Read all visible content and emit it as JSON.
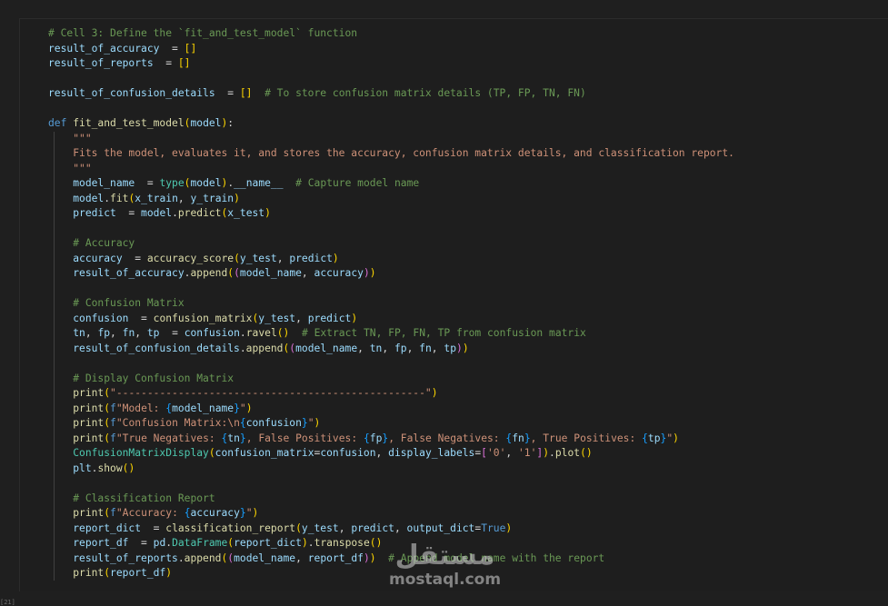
{
  "code_lines": [
    [
      [
        "cm",
        "# Cell 3: Define the `fit_and_test_model` function"
      ]
    ],
    [
      [
        "var",
        "result_of_accuracy"
      ],
      [
        "",
        "  = "
      ],
      [
        "brk",
        "[]"
      ]
    ],
    [
      [
        "var",
        "result_of_reports"
      ],
      [
        "",
        "  = "
      ],
      [
        "brk",
        "[]"
      ]
    ],
    [],
    [
      [
        "var",
        "result_of_confusion_details"
      ],
      [
        "",
        "  = "
      ],
      [
        "brk",
        "[]"
      ],
      [
        "",
        "  "
      ],
      [
        "cm",
        "# To store confusion matrix details (TP, FP, TN, FN)"
      ]
    ],
    [],
    [
      [
        "kw",
        "def"
      ],
      [
        "",
        " "
      ],
      [
        "fn",
        "fit_and_test_model"
      ],
      [
        "brk",
        "("
      ],
      [
        "var",
        "model"
      ],
      [
        "brk",
        ")"
      ],
      [
        "",
        ":"
      ]
    ],
    [
      [
        "",
        "    "
      ],
      [
        "str",
        "\"\"\""
      ]
    ],
    [
      [
        "",
        "    "
      ],
      [
        "str",
        "Fits the model, evaluates it, and stores the accuracy, confusion matrix details, and classification report."
      ]
    ],
    [
      [
        "",
        "    "
      ],
      [
        "str",
        "\"\"\""
      ]
    ],
    [
      [
        "",
        "    "
      ],
      [
        "var",
        "model_name"
      ],
      [
        "",
        "  = "
      ],
      [
        "cls",
        "type"
      ],
      [
        "brk",
        "("
      ],
      [
        "var",
        "model"
      ],
      [
        "brk",
        ")"
      ],
      [
        "",
        "."
      ],
      [
        "var",
        "__name__"
      ],
      [
        "",
        "  "
      ],
      [
        "cm",
        "# Capture model name"
      ]
    ],
    [
      [
        "",
        "    "
      ],
      [
        "var",
        "model"
      ],
      [
        "",
        "."
      ],
      [
        "fn",
        "fit"
      ],
      [
        "brk",
        "("
      ],
      [
        "var",
        "x_train"
      ],
      [
        "",
        ", "
      ],
      [
        "var",
        "y_train"
      ],
      [
        "brk",
        ")"
      ]
    ],
    [
      [
        "",
        "    "
      ],
      [
        "var",
        "predict"
      ],
      [
        "",
        "  = "
      ],
      [
        "var",
        "model"
      ],
      [
        "",
        "."
      ],
      [
        "fn",
        "predict"
      ],
      [
        "brk",
        "("
      ],
      [
        "var",
        "x_test"
      ],
      [
        "brk",
        ")"
      ]
    ],
    [],
    [
      [
        "",
        "    "
      ],
      [
        "cm",
        "# Accuracy"
      ]
    ],
    [
      [
        "",
        "    "
      ],
      [
        "var",
        "accuracy"
      ],
      [
        "",
        "  = "
      ],
      [
        "fn",
        "accuracy_score"
      ],
      [
        "brk",
        "("
      ],
      [
        "var",
        "y_test"
      ],
      [
        "",
        ", "
      ],
      [
        "var",
        "predict"
      ],
      [
        "brk",
        ")"
      ]
    ],
    [
      [
        "",
        "    "
      ],
      [
        "var",
        "result_of_accuracy"
      ],
      [
        "",
        "."
      ],
      [
        "fn",
        "append"
      ],
      [
        "brk",
        "("
      ],
      [
        "brk2",
        "("
      ],
      [
        "var",
        "model_name"
      ],
      [
        "",
        ", "
      ],
      [
        "var",
        "accuracy"
      ],
      [
        "brk2",
        ")"
      ],
      [
        "brk",
        ")"
      ]
    ],
    [],
    [
      [
        "",
        "    "
      ],
      [
        "cm",
        "# Confusion Matrix"
      ]
    ],
    [
      [
        "",
        "    "
      ],
      [
        "var",
        "confusion"
      ],
      [
        "",
        "  = "
      ],
      [
        "fn",
        "confusion_matrix"
      ],
      [
        "brk",
        "("
      ],
      [
        "var",
        "y_test"
      ],
      [
        "",
        ", "
      ],
      [
        "var",
        "predict"
      ],
      [
        "brk",
        ")"
      ]
    ],
    [
      [
        "",
        "    "
      ],
      [
        "var",
        "tn"
      ],
      [
        "",
        ", "
      ],
      [
        "var",
        "fp"
      ],
      [
        "",
        ", "
      ],
      [
        "var",
        "fn"
      ],
      [
        "",
        ", "
      ],
      [
        "var",
        "tp"
      ],
      [
        "",
        "  = "
      ],
      [
        "var",
        "confusion"
      ],
      [
        "",
        "."
      ],
      [
        "fn",
        "ravel"
      ],
      [
        "brk",
        "()"
      ],
      [
        "",
        "  "
      ],
      [
        "cm",
        "# Extract TN, FP, FN, TP from confusion matrix"
      ]
    ],
    [
      [
        "",
        "    "
      ],
      [
        "var",
        "result_of_confusion_details"
      ],
      [
        "",
        "."
      ],
      [
        "fn",
        "append"
      ],
      [
        "brk",
        "("
      ],
      [
        "brk2",
        "("
      ],
      [
        "var",
        "model_name"
      ],
      [
        "",
        ", "
      ],
      [
        "var",
        "tn"
      ],
      [
        "",
        ", "
      ],
      [
        "var",
        "fp"
      ],
      [
        "",
        ", "
      ],
      [
        "var",
        "fn"
      ],
      [
        "",
        ", "
      ],
      [
        "var",
        "tp"
      ],
      [
        "brk2",
        ")"
      ],
      [
        "brk",
        ")"
      ]
    ],
    [],
    [
      [
        "",
        "    "
      ],
      [
        "cm",
        "# Display Confusion Matrix"
      ]
    ],
    [
      [
        "",
        "    "
      ],
      [
        "fn",
        "print"
      ],
      [
        "brk",
        "("
      ],
      [
        "str",
        "\"--------------------------------------------------\""
      ],
      [
        "brk",
        ")"
      ]
    ],
    [
      [
        "",
        "    "
      ],
      [
        "fn",
        "print"
      ],
      [
        "brk",
        "("
      ],
      [
        "kw",
        "f"
      ],
      [
        "str",
        "\"Model: "
      ],
      [
        "brk3",
        "{"
      ],
      [
        "var",
        "model_name"
      ],
      [
        "brk3",
        "}"
      ],
      [
        "str",
        "\""
      ],
      [
        "brk",
        ")"
      ]
    ],
    [
      [
        "",
        "    "
      ],
      [
        "fn",
        "print"
      ],
      [
        "brk",
        "("
      ],
      [
        "kw",
        "f"
      ],
      [
        "str",
        "\"Confusion Matrix:\\n"
      ],
      [
        "brk3",
        "{"
      ],
      [
        "var",
        "confusion"
      ],
      [
        "brk3",
        "}"
      ],
      [
        "str",
        "\""
      ],
      [
        "brk",
        ")"
      ]
    ],
    [
      [
        "",
        "    "
      ],
      [
        "fn",
        "print"
      ],
      [
        "brk",
        "("
      ],
      [
        "kw",
        "f"
      ],
      [
        "str",
        "\"True Negatives: "
      ],
      [
        "brk3",
        "{"
      ],
      [
        "var",
        "tn"
      ],
      [
        "brk3",
        "}"
      ],
      [
        "str",
        ", False Positives: "
      ],
      [
        "brk3",
        "{"
      ],
      [
        "var",
        "fp"
      ],
      [
        "brk3",
        "}"
      ],
      [
        "str",
        ", False Negatives: "
      ],
      [
        "brk3",
        "{"
      ],
      [
        "var",
        "fn"
      ],
      [
        "brk3",
        "}"
      ],
      [
        "str",
        ", True Positives: "
      ],
      [
        "brk3",
        "{"
      ],
      [
        "var",
        "tp"
      ],
      [
        "brk3",
        "}"
      ],
      [
        "str",
        "\""
      ],
      [
        "brk",
        ")"
      ]
    ],
    [
      [
        "",
        "    "
      ],
      [
        "cls",
        "ConfusionMatrixDisplay"
      ],
      [
        "brk",
        "("
      ],
      [
        "var",
        "confusion_matrix"
      ],
      [
        "",
        "="
      ],
      [
        "var",
        "confusion"
      ],
      [
        "",
        ", "
      ],
      [
        "var",
        "display_labels"
      ],
      [
        "",
        "="
      ],
      [
        "brk2",
        "["
      ],
      [
        "str",
        "'0'"
      ],
      [
        "",
        ", "
      ],
      [
        "str",
        "'1'"
      ],
      [
        "brk2",
        "]"
      ],
      [
        "brk",
        ")"
      ],
      [
        "",
        "."
      ],
      [
        "fn",
        "plot"
      ],
      [
        "brk",
        "()"
      ]
    ],
    [
      [
        "",
        "    "
      ],
      [
        "var",
        "plt"
      ],
      [
        "",
        "."
      ],
      [
        "fn",
        "show"
      ],
      [
        "brk",
        "()"
      ]
    ],
    [],
    [
      [
        "",
        "    "
      ],
      [
        "cm",
        "# Classification Report"
      ]
    ],
    [
      [
        "",
        "    "
      ],
      [
        "fn",
        "print"
      ],
      [
        "brk",
        "("
      ],
      [
        "kw",
        "f"
      ],
      [
        "str",
        "\"Accuracy: "
      ],
      [
        "brk3",
        "{"
      ],
      [
        "var",
        "accuracy"
      ],
      [
        "brk3",
        "}"
      ],
      [
        "str",
        "\""
      ],
      [
        "brk",
        ")"
      ]
    ],
    [
      [
        "",
        "    "
      ],
      [
        "var",
        "report_dict"
      ],
      [
        "",
        "  = "
      ],
      [
        "fn",
        "classification_report"
      ],
      [
        "brk",
        "("
      ],
      [
        "var",
        "y_test"
      ],
      [
        "",
        ", "
      ],
      [
        "var",
        "predict"
      ],
      [
        "",
        ", "
      ],
      [
        "var",
        "output_dict"
      ],
      [
        "",
        "="
      ],
      [
        "kw",
        "True"
      ],
      [
        "brk",
        ")"
      ]
    ],
    [
      [
        "",
        "    "
      ],
      [
        "var",
        "report_df"
      ],
      [
        "",
        "  = "
      ],
      [
        "var",
        "pd"
      ],
      [
        "",
        "."
      ],
      [
        "cls",
        "DataFrame"
      ],
      [
        "brk",
        "("
      ],
      [
        "var",
        "report_dict"
      ],
      [
        "brk",
        ")"
      ],
      [
        "",
        "."
      ],
      [
        "fn",
        "transpose"
      ],
      [
        "brk",
        "()"
      ]
    ],
    [
      [
        "",
        "    "
      ],
      [
        "var",
        "result_of_reports"
      ],
      [
        "",
        "."
      ],
      [
        "fn",
        "append"
      ],
      [
        "brk",
        "("
      ],
      [
        "brk2",
        "("
      ],
      [
        "var",
        "model_name"
      ],
      [
        "",
        ", "
      ],
      [
        "var",
        "report_df"
      ],
      [
        "brk2",
        ")"
      ],
      [
        "brk",
        ")"
      ],
      [
        "",
        "  "
      ],
      [
        "cm",
        "# Append model name with the report"
      ]
    ],
    [
      [
        "",
        "    "
      ],
      [
        "fn",
        "print"
      ],
      [
        "brk",
        "("
      ],
      [
        "var",
        "report_df"
      ],
      [
        "brk",
        ")"
      ]
    ]
  ],
  "watermark": {
    "logo": "مستقل",
    "text": "mostaql.com"
  },
  "corner_label": "[21]"
}
